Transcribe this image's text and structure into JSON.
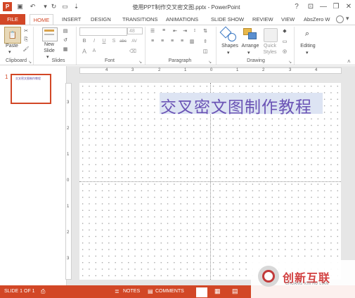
{
  "app": {
    "title": "使用PPT制作交叉密文图.pptx - PowerPoint",
    "window_buttons": [
      "?",
      "⊡",
      "—",
      "❐",
      "✕"
    ],
    "user": "AbsZero W"
  },
  "tabs": [
    "FILE",
    "HOME",
    "INSERT",
    "DESIGN",
    "TRANSITIONS",
    "ANIMATIONS",
    "SLIDE SHOW",
    "REVIEW",
    "VIEW"
  ],
  "ribbon": {
    "clipboard": {
      "label": "Clipboard",
      "paste": "Paste"
    },
    "slides": {
      "label": "Slides",
      "new_slide_line1": "New",
      "new_slide_line2": "Slide"
    },
    "font": {
      "label": "Font",
      "font_name": "",
      "font_size": "48",
      "format_buttons": [
        "B",
        "I",
        "U",
        "S",
        "abc",
        "AV"
      ],
      "case_buttons": [
        "A",
        "A"
      ]
    },
    "paragraph": {
      "label": "Paragraph"
    },
    "drawing": {
      "label": "Drawing",
      "shapes": "Shapes",
      "arrange": "Arrange",
      "quick_styles_line1": "Quick",
      "quick_styles_line2": "Styles"
    },
    "editing": {
      "label": "Editing"
    }
  },
  "thumbnails": [
    {
      "number": "1",
      "text": "交叉密文图制作教程"
    }
  ],
  "ruler": {
    "horizontal": [
      "4",
      "3",
      "2",
      "1",
      "0",
      "1",
      "2",
      "3",
      "4"
    ],
    "vertical": [
      "3",
      "2",
      "1",
      "0",
      "1",
      "2",
      "3"
    ]
  },
  "slide": {
    "title": "交叉密文图制作教程"
  },
  "status": {
    "slide": "SLIDE 1 OF 1",
    "notes": "NOTES",
    "comments": "COMMENTS"
  },
  "watermark": {
    "text": "创新互联",
    "sub": "CHUANG XIN HU LIAN"
  },
  "colors": {
    "accent": "#d24726",
    "title_text": "#6a53b5"
  }
}
